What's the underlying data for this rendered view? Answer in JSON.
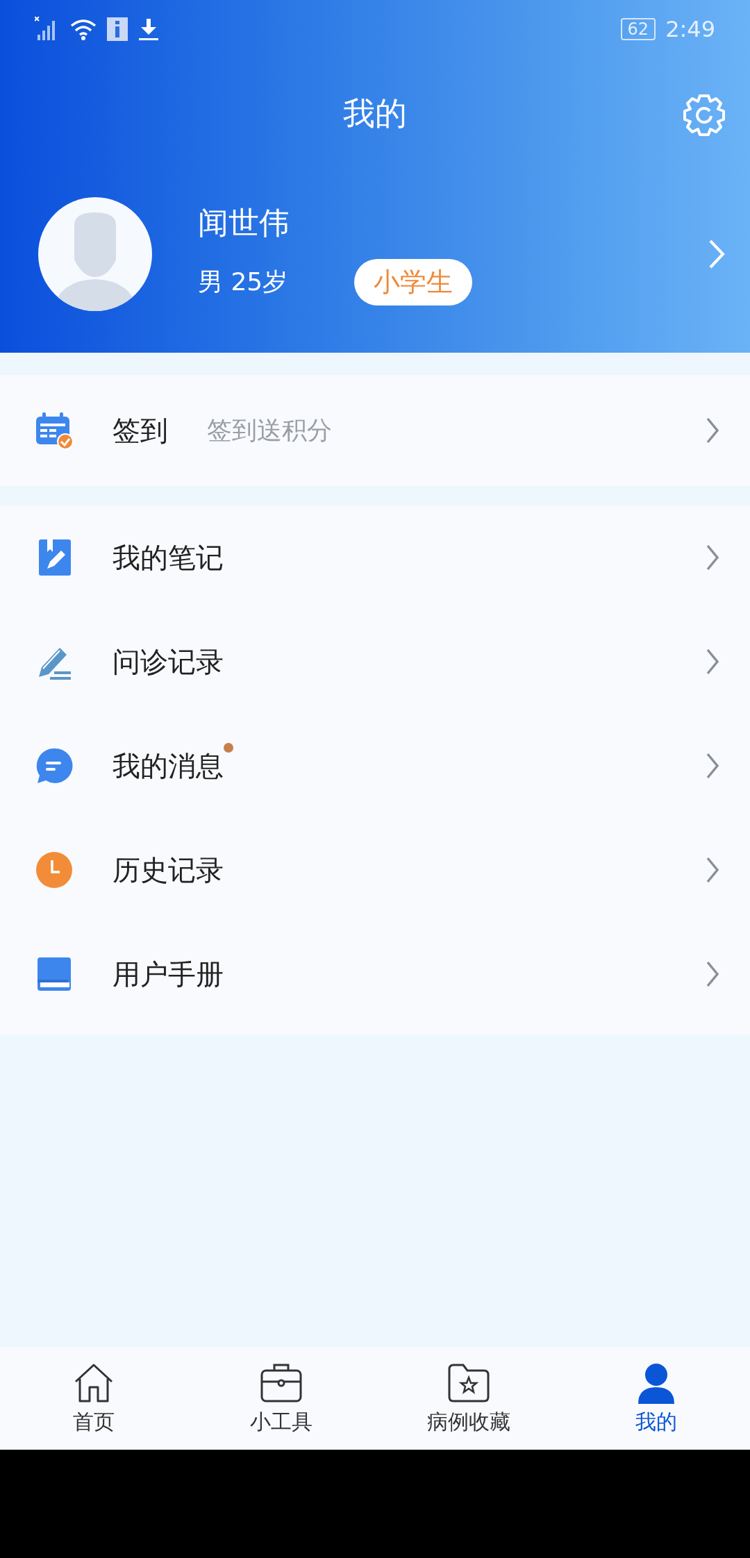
{
  "status_bar": {
    "battery": "62",
    "time": "2:49"
  },
  "header": {
    "title": "我的"
  },
  "profile": {
    "name": "闻世伟",
    "info": "男 25岁",
    "tag": "小学生"
  },
  "checkin": {
    "label": "签到",
    "hint": "签到送积分"
  },
  "menu": [
    {
      "label": "我的笔记",
      "badge": false
    },
    {
      "label": "问诊记录",
      "badge": false
    },
    {
      "label": "我的消息",
      "badge": true
    },
    {
      "label": "历史记录",
      "badge": false
    },
    {
      "label": "用户手册",
      "badge": false
    }
  ],
  "nav": [
    {
      "label": "首页",
      "selected": false
    },
    {
      "label": "小工具",
      "selected": false
    },
    {
      "label": "病例收藏",
      "selected": false
    },
    {
      "label": "我的",
      "selected": true
    }
  ]
}
